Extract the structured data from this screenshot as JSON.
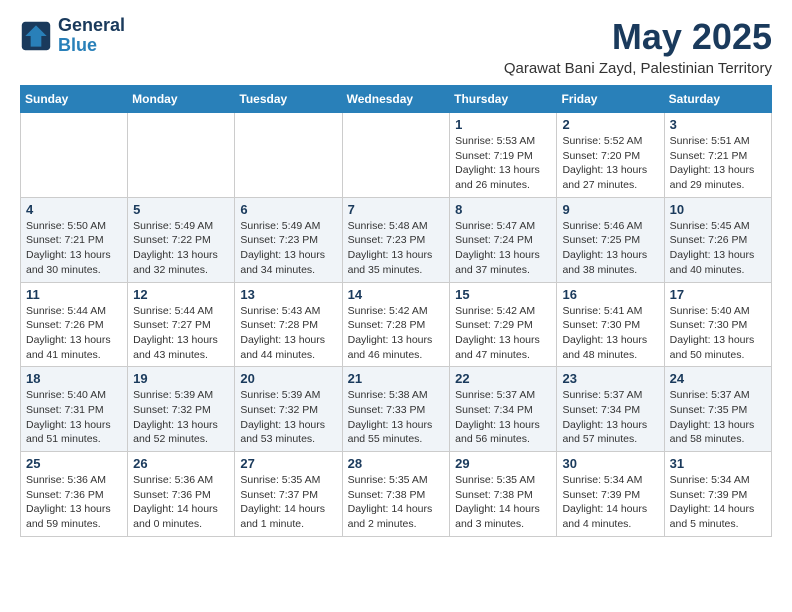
{
  "logo": {
    "line1": "General",
    "line2": "Blue"
  },
  "title": "May 2025",
  "location": "Qarawat Bani Zayd, Palestinian Territory",
  "headers": [
    "Sunday",
    "Monday",
    "Tuesday",
    "Wednesday",
    "Thursday",
    "Friday",
    "Saturday"
  ],
  "weeks": [
    [
      {
        "day": "",
        "info": ""
      },
      {
        "day": "",
        "info": ""
      },
      {
        "day": "",
        "info": ""
      },
      {
        "day": "",
        "info": ""
      },
      {
        "day": "1",
        "info": "Sunrise: 5:53 AM\nSunset: 7:19 PM\nDaylight: 13 hours and 26 minutes."
      },
      {
        "day": "2",
        "info": "Sunrise: 5:52 AM\nSunset: 7:20 PM\nDaylight: 13 hours and 27 minutes."
      },
      {
        "day": "3",
        "info": "Sunrise: 5:51 AM\nSunset: 7:21 PM\nDaylight: 13 hours and 29 minutes."
      }
    ],
    [
      {
        "day": "4",
        "info": "Sunrise: 5:50 AM\nSunset: 7:21 PM\nDaylight: 13 hours and 30 minutes."
      },
      {
        "day": "5",
        "info": "Sunrise: 5:49 AM\nSunset: 7:22 PM\nDaylight: 13 hours and 32 minutes."
      },
      {
        "day": "6",
        "info": "Sunrise: 5:49 AM\nSunset: 7:23 PM\nDaylight: 13 hours and 34 minutes."
      },
      {
        "day": "7",
        "info": "Sunrise: 5:48 AM\nSunset: 7:23 PM\nDaylight: 13 hours and 35 minutes."
      },
      {
        "day": "8",
        "info": "Sunrise: 5:47 AM\nSunset: 7:24 PM\nDaylight: 13 hours and 37 minutes."
      },
      {
        "day": "9",
        "info": "Sunrise: 5:46 AM\nSunset: 7:25 PM\nDaylight: 13 hours and 38 minutes."
      },
      {
        "day": "10",
        "info": "Sunrise: 5:45 AM\nSunset: 7:26 PM\nDaylight: 13 hours and 40 minutes."
      }
    ],
    [
      {
        "day": "11",
        "info": "Sunrise: 5:44 AM\nSunset: 7:26 PM\nDaylight: 13 hours and 41 minutes."
      },
      {
        "day": "12",
        "info": "Sunrise: 5:44 AM\nSunset: 7:27 PM\nDaylight: 13 hours and 43 minutes."
      },
      {
        "day": "13",
        "info": "Sunrise: 5:43 AM\nSunset: 7:28 PM\nDaylight: 13 hours and 44 minutes."
      },
      {
        "day": "14",
        "info": "Sunrise: 5:42 AM\nSunset: 7:28 PM\nDaylight: 13 hours and 46 minutes."
      },
      {
        "day": "15",
        "info": "Sunrise: 5:42 AM\nSunset: 7:29 PM\nDaylight: 13 hours and 47 minutes."
      },
      {
        "day": "16",
        "info": "Sunrise: 5:41 AM\nSunset: 7:30 PM\nDaylight: 13 hours and 48 minutes."
      },
      {
        "day": "17",
        "info": "Sunrise: 5:40 AM\nSunset: 7:30 PM\nDaylight: 13 hours and 50 minutes."
      }
    ],
    [
      {
        "day": "18",
        "info": "Sunrise: 5:40 AM\nSunset: 7:31 PM\nDaylight: 13 hours and 51 minutes."
      },
      {
        "day": "19",
        "info": "Sunrise: 5:39 AM\nSunset: 7:32 PM\nDaylight: 13 hours and 52 minutes."
      },
      {
        "day": "20",
        "info": "Sunrise: 5:39 AM\nSunset: 7:32 PM\nDaylight: 13 hours and 53 minutes."
      },
      {
        "day": "21",
        "info": "Sunrise: 5:38 AM\nSunset: 7:33 PM\nDaylight: 13 hours and 55 minutes."
      },
      {
        "day": "22",
        "info": "Sunrise: 5:37 AM\nSunset: 7:34 PM\nDaylight: 13 hours and 56 minutes."
      },
      {
        "day": "23",
        "info": "Sunrise: 5:37 AM\nSunset: 7:34 PM\nDaylight: 13 hours and 57 minutes."
      },
      {
        "day": "24",
        "info": "Sunrise: 5:37 AM\nSunset: 7:35 PM\nDaylight: 13 hours and 58 minutes."
      }
    ],
    [
      {
        "day": "25",
        "info": "Sunrise: 5:36 AM\nSunset: 7:36 PM\nDaylight: 13 hours and 59 minutes."
      },
      {
        "day": "26",
        "info": "Sunrise: 5:36 AM\nSunset: 7:36 PM\nDaylight: 14 hours and 0 minutes."
      },
      {
        "day": "27",
        "info": "Sunrise: 5:35 AM\nSunset: 7:37 PM\nDaylight: 14 hours and 1 minute."
      },
      {
        "day": "28",
        "info": "Sunrise: 5:35 AM\nSunset: 7:38 PM\nDaylight: 14 hours and 2 minutes."
      },
      {
        "day": "29",
        "info": "Sunrise: 5:35 AM\nSunset: 7:38 PM\nDaylight: 14 hours and 3 minutes."
      },
      {
        "day": "30",
        "info": "Sunrise: 5:34 AM\nSunset: 7:39 PM\nDaylight: 14 hours and 4 minutes."
      },
      {
        "day": "31",
        "info": "Sunrise: 5:34 AM\nSunset: 7:39 PM\nDaylight: 14 hours and 5 minutes."
      }
    ]
  ]
}
